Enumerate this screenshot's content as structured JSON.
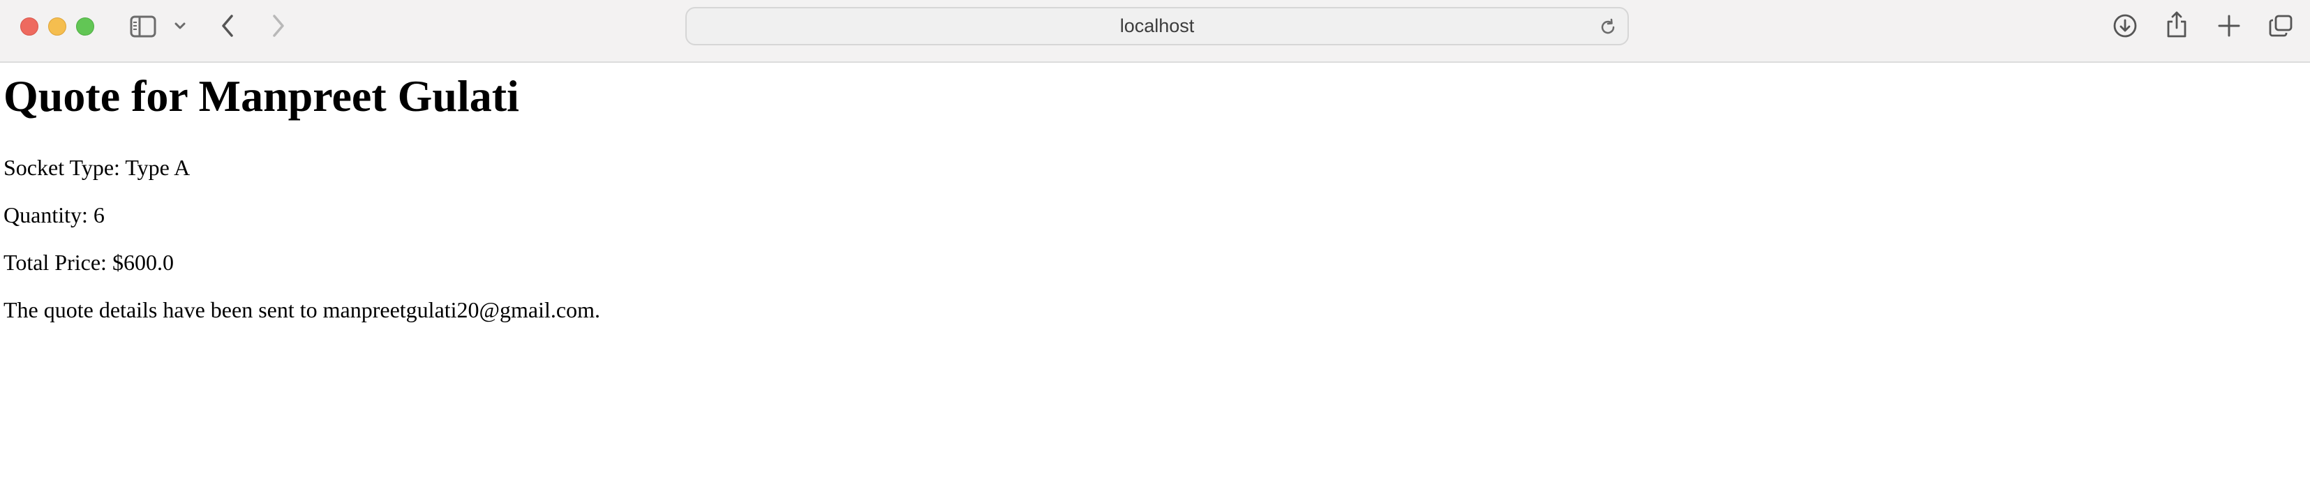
{
  "browser": {
    "address": "localhost",
    "icons": {
      "sidebar": "sidebar-icon",
      "sidebar_menu": "chevron-down-icon",
      "back": "chevron-left-icon",
      "forward": "chevron-right-icon",
      "reload": "reload-icon",
      "downloads": "download-icon",
      "share": "share-icon",
      "new_tab": "plus-icon",
      "tabs": "tabs-overview-icon"
    }
  },
  "page": {
    "heading": "Quote for Manpreet Gulati",
    "socket_type": "Socket Type: Type A",
    "quantity": "Quantity: 6",
    "total_price": "Total Price: $600.0",
    "confirmation": "The quote details have been sent to manpreetgulati20@gmail.com."
  }
}
